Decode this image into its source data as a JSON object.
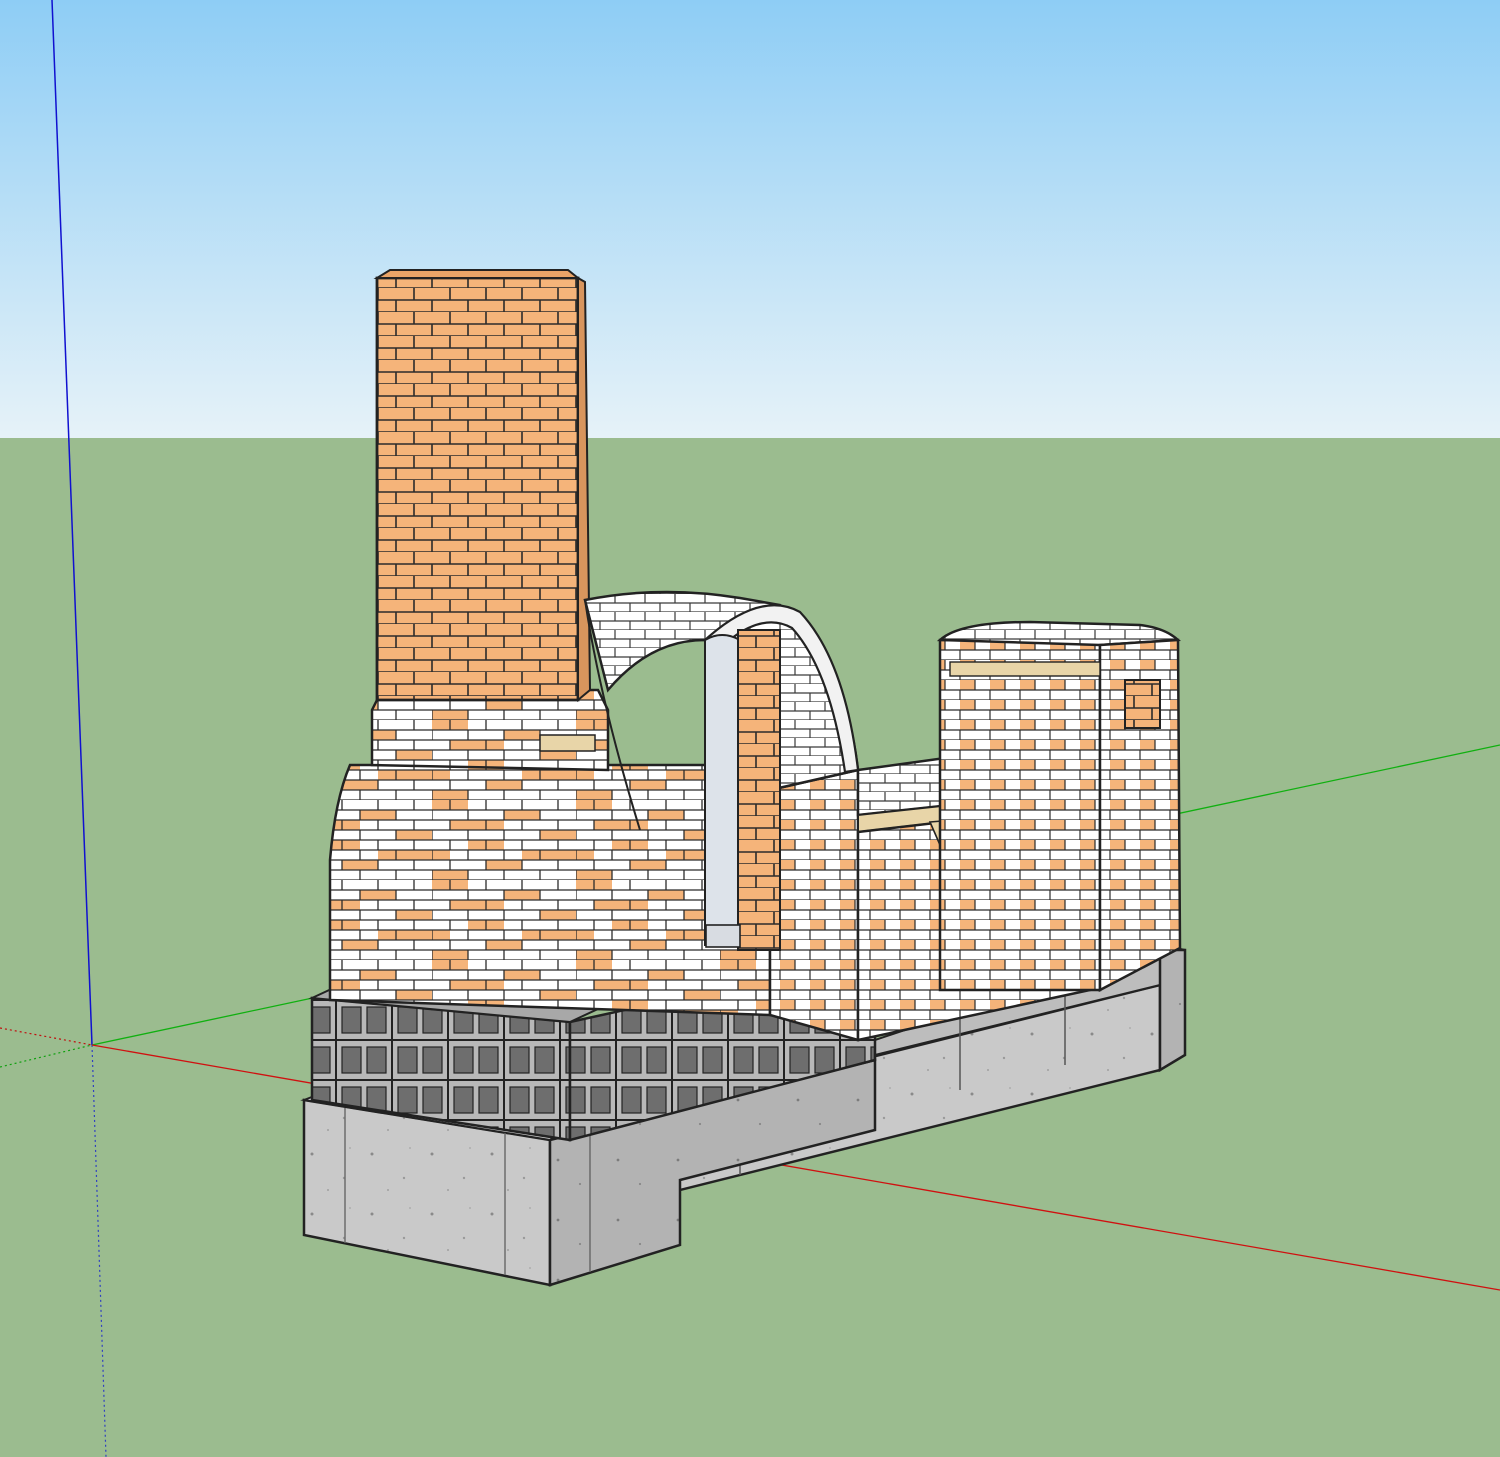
{
  "app": {
    "view": "3d-model-viewport"
  },
  "scene": {
    "colors": {
      "sky_top": "#8ecdf5",
      "sky_bottom": "#e6f2f8",
      "ground": "#9bbc8f",
      "red_brick": "#f5b47a",
      "firebrick": "#ffffff",
      "mortar_line": "#2b2b2b",
      "concrete": "#c8c8c8",
      "cinder_block": "#b8b8b8",
      "axis_red": "#d01010",
      "axis_green": "#10b010",
      "axis_blue": "#1010d0"
    },
    "icons": {
      "origin": "axis-origin-icon"
    }
  }
}
